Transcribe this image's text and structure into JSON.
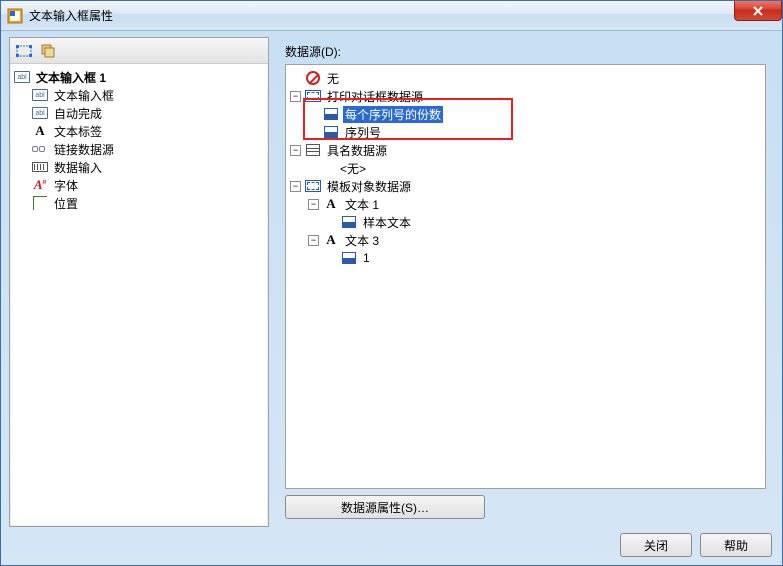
{
  "window": {
    "title": "文本输入框属性"
  },
  "toolbar_icons": {
    "select_all": "select-all",
    "copy": "copy"
  },
  "left_tree": {
    "root_label": "文本输入框 1",
    "items": [
      {
        "label": "文本输入框",
        "icon": "abl"
      },
      {
        "label": "自动完成",
        "icon": "abl"
      },
      {
        "label": "文本标签",
        "icon": "A"
      },
      {
        "label": "链接数据源",
        "icon": "link",
        "current": true
      },
      {
        "label": "数据输入",
        "icon": "kb"
      },
      {
        "label": "字体",
        "icon": "font"
      },
      {
        "label": "位置",
        "icon": "pos"
      }
    ]
  },
  "right": {
    "header_label": "数据源(D):",
    "tree": {
      "none_label": "无",
      "print_dialog": {
        "label": "打印对话框数据源",
        "children": [
          {
            "label": "每个序列号的份数",
            "selected": true
          },
          {
            "label": "序列号"
          }
        ]
      },
      "named": {
        "label": "具名数据源",
        "none_text": "<无>"
      },
      "template": {
        "label": "模板对象数据源",
        "items": [
          {
            "label": "文本 1",
            "child": "样本文本"
          },
          {
            "label": "文本 3",
            "child": "1"
          }
        ]
      }
    },
    "prop_button": "数据源属性(S)…"
  },
  "footer": {
    "close": "关闭",
    "help": "帮助"
  }
}
